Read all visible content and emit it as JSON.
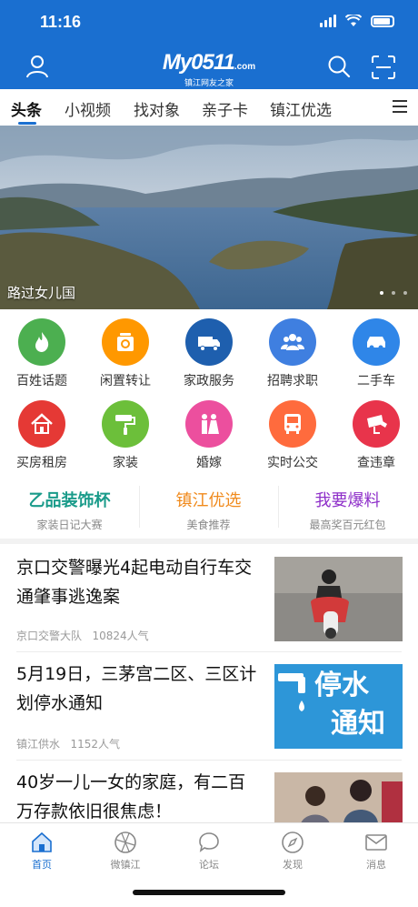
{
  "status": {
    "time": "11:16"
  },
  "header": {
    "logo_main": "My0511",
    "logo_suffix": ".com",
    "logo_sub": "镇江网友之家"
  },
  "tabs": [
    {
      "label": "头条",
      "active": true
    },
    {
      "label": "小视频"
    },
    {
      "label": "找对象"
    },
    {
      "label": "亲子卡"
    },
    {
      "label": "镇江优选"
    }
  ],
  "banner": {
    "caption": "路过女儿国",
    "slides": 3
  },
  "grid": [
    {
      "label": "百姓话题",
      "icon": "flame-icon",
      "color": "#4caf50"
    },
    {
      "label": "闲置转让",
      "icon": "recycle-icon",
      "color": "#ff9800"
    },
    {
      "label": "家政服务",
      "icon": "truck-icon",
      "color": "#1e5fae"
    },
    {
      "label": "招聘求职",
      "icon": "people-icon",
      "color": "#3f7fe0"
    },
    {
      "label": "二手车",
      "icon": "car-icon",
      "color": "#2f86e8"
    },
    {
      "label": "买房租房",
      "icon": "house-icon",
      "color": "#e53935"
    },
    {
      "label": "家装",
      "icon": "paint-roller-icon",
      "color": "#6cbf3a"
    },
    {
      "label": "婚嫁",
      "icon": "couple-icon",
      "color": "#ec4f9e"
    },
    {
      "label": "实时公交",
      "icon": "bus-icon",
      "color": "#ff6b3d"
    },
    {
      "label": "查违章",
      "icon": "camera-icon",
      "color": "#e8344b"
    }
  ],
  "promos": [
    {
      "title": "乙品装饰杯",
      "sub": "家装日记大赛",
      "color": "#1a9b8a"
    },
    {
      "title": "镇江优选",
      "sub": "美食推荐",
      "color": "#f08a1c"
    },
    {
      "title": "我要爆料",
      "sub": "最高奖百元红包",
      "color": "#8e2fc9"
    }
  ],
  "articles": [
    {
      "title": "京口交警曝光4起电动自行车交通肇事逃逸案",
      "source": "京口交警大队",
      "views": "10824人气"
    },
    {
      "title": "5月19日，三茅宫二区、三区计划停水通知",
      "source": "镇江供水",
      "views": "1152人气",
      "image_text_1": "停水",
      "image_text_2": "通知"
    },
    {
      "title": "40岁一儿一女的家庭，有二百万存款依旧很焦虑！"
    }
  ],
  "tabbar": [
    {
      "label": "首页",
      "icon": "home-icon",
      "active": true
    },
    {
      "label": "微镇江",
      "icon": "aperture-icon"
    },
    {
      "label": "论坛",
      "icon": "chat-bubble-icon"
    },
    {
      "label": "发现",
      "icon": "compass-icon"
    },
    {
      "label": "消息",
      "icon": "mail-icon"
    }
  ],
  "colors": {
    "brand": "#1a6fd0"
  }
}
